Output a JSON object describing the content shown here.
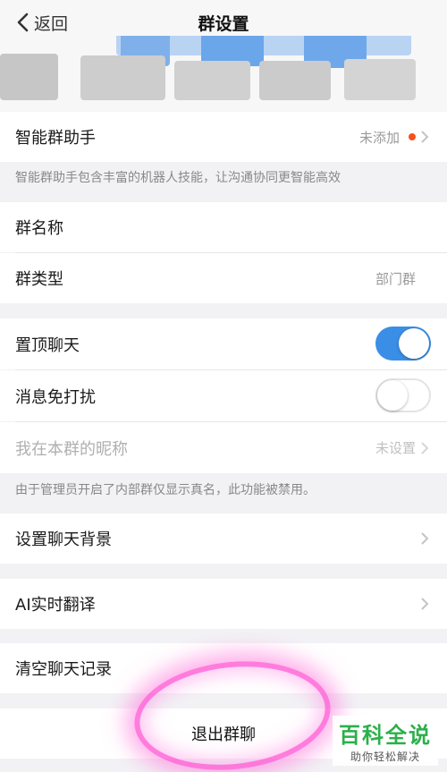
{
  "nav": {
    "back_label": "返回",
    "title": "群设置"
  },
  "assistant": {
    "label": "智能群助手",
    "status": "未添加",
    "description": "智能群助手包含丰富的机器人技能，让沟通协同更智能高效"
  },
  "group_name": {
    "label": "群名称"
  },
  "group_type": {
    "label": "群类型",
    "value": "部门群"
  },
  "pin_chat": {
    "label": "置顶聊天",
    "enabled": true
  },
  "do_not_disturb": {
    "label": "消息免打扰",
    "enabled": false
  },
  "nickname": {
    "label": "我在本群的昵称",
    "value": "未设置",
    "note": "由于管理员开启了内部群仅显示真名，此功能被禁用。"
  },
  "chat_background": {
    "label": "设置聊天背景"
  },
  "ai_translate": {
    "label": "AI实时翻译"
  },
  "clear_history": {
    "label": "清空聊天记录"
  },
  "exit_group": {
    "label": "退出群聊"
  },
  "watermark": {
    "line1": "百科全说",
    "line2": "助你轻松解决"
  },
  "colors": {
    "accent": "#3a8ee6",
    "dot": "#f4511e",
    "highlight": "#ff50d2",
    "brand": "#2bb04a"
  }
}
